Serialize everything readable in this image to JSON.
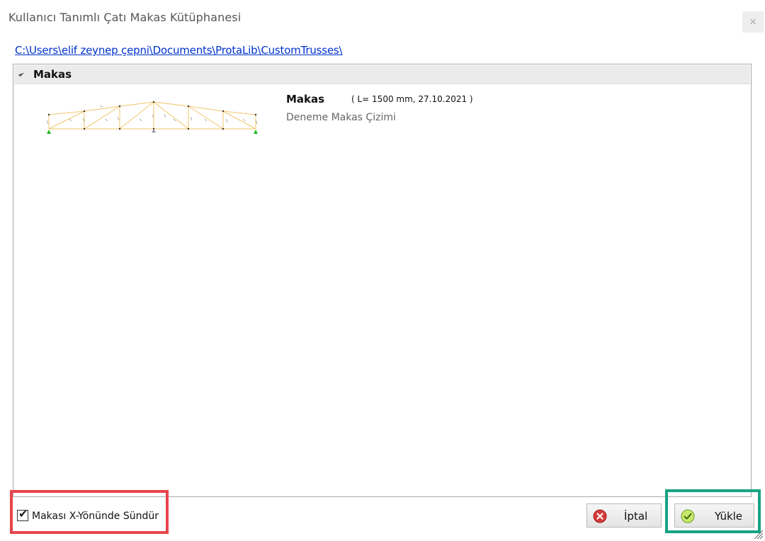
{
  "window": {
    "title": "Kullanıcı Tanımlı Çatı Makas Kütüphanesi",
    "close_label": "×"
  },
  "library_path": "C:\\Users\\elif zeynep çepni\\Documents\\ProtaLib\\CustomTrusses\\",
  "group": {
    "title": "Makas"
  },
  "item": {
    "name": "Makas",
    "meta": "( L= 1500 mm, 27.10.2021 )",
    "description": "Deneme Makas Çizimi"
  },
  "options": {
    "extend_x_label": "Makası X-Yönünde Sündür",
    "extend_x_checked": true
  },
  "buttons": {
    "cancel_label": "İptal",
    "load_label": "Yükle"
  },
  "colors": {
    "link": "#0033cc",
    "highlight_red": "#e8454a",
    "highlight_green": "#17a383",
    "truss_member": "#f2c56b",
    "support": "#22bb22"
  }
}
